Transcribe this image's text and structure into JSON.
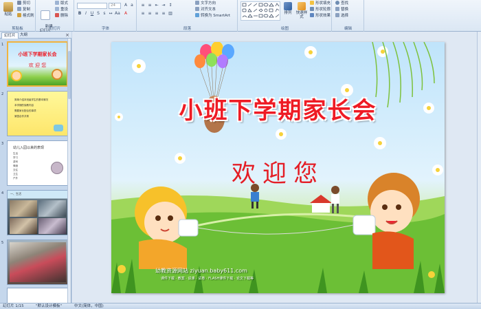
{
  "ribbon": {
    "clipboard": {
      "paste": "粘贴",
      "cut": "剪切",
      "copy": "复制",
      "format_painter": "格式刷",
      "label": "剪贴板"
    },
    "slides": {
      "new_slide": "新建\n幻灯片",
      "layout": "版式",
      "reset": "重设",
      "delete": "删除",
      "label": "幻灯片"
    },
    "font": {
      "font_name": "",
      "font_size": "24",
      "label": "字体"
    },
    "paragraph": {
      "text_direction": "文字方向",
      "align_text": "对齐文本",
      "convert_smartart": "转换为 SmartArt",
      "label": "段落"
    },
    "drawing": {
      "arrange": "排列",
      "quick_styles": "快速样式",
      "shape_fill": "形状填充",
      "shape_outline": "形状轮廓",
      "shape_effects": "形状效果",
      "label": "绘图"
    },
    "editing": {
      "find": "查找",
      "replace": "替换",
      "select": "选择",
      "label": "编辑"
    }
  },
  "panel": {
    "tab_slides": "幻灯片",
    "tab_outline": "大纲",
    "close": "×",
    "thumbnails": [
      {
        "num": "1",
        "title": "小班下学期家长会",
        "subtitle": "欢 迎 您"
      },
      {
        "num": "2",
        "lines": [
          "简单介绍本班级学生的基本情况",
          "本学期的保教内容",
          "需要家长配合的事项",
          "家园合作共育"
        ]
      },
      {
        "num": "3",
        "heading": "幼儿入园以来的表现",
        "items": [
          "生活",
          "学习",
          "游戏",
          "情绪",
          "交往",
          "卫生",
          "户外"
        ]
      },
      {
        "num": "4",
        "caption": "一、生活"
      },
      {
        "num": "5",
        "caption": ""
      }
    ]
  },
  "slide": {
    "title": "小班下学期家长会",
    "subtitle": "欢迎您",
    "site": "幼教资源网站 ziyuan.baby611.com",
    "site_sub": "课件下载 · 教案 · 说课 · 试卷 · FLASH课件下载 · 论文下载等"
  },
  "status": {
    "slide_info": "幻灯片 1/15",
    "theme": "\"默认设计模板\"",
    "language": "中文(简体，中国)"
  },
  "colors": {
    "title_red": "#ee1b24",
    "ribbon_bg": "#dbe7f4",
    "selected_border": "#f2b33d"
  }
}
